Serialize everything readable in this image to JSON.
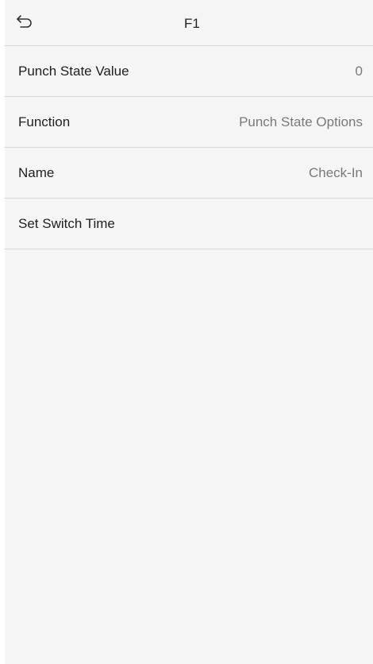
{
  "header": {
    "title": "F1",
    "back_icon": "back-arrow-icon"
  },
  "rows": [
    {
      "label": "Punch State Value",
      "value": "0"
    },
    {
      "label": "Function",
      "value": "Punch State Options"
    },
    {
      "label": "Name",
      "value": "Check-In"
    },
    {
      "label": "Set Switch Time",
      "value": ""
    }
  ],
  "colors": {
    "background": "#f5f5f5",
    "divider": "#d9d9d9",
    "label_text": "#1f1f1f",
    "value_text": "#7a7a7a"
  }
}
